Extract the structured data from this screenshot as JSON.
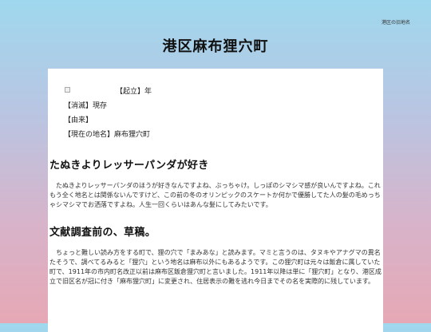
{
  "nav": {
    "old_names_link": "港区の旧地名"
  },
  "header": {
    "title": "港区麻布狸穴町"
  },
  "info": {
    "established": "【起立】年",
    "abolished": "【消滅】現存",
    "origin": "【由来】",
    "current_name": "【現在の地名】麻布狸穴町"
  },
  "sections": [
    {
      "heading": "たぬきよりレッサーパンダが好き",
      "body": "たぬきよりレッサーパンダのほうが好きなんですよね、ぶっちゃけ。しっぽのシマシマ感が良いんですよね。これもう全く地名とは関係ないんですけど、この前の冬のオリンピックのスケートか何かで優勝してた人の髪の毛めっちゃシマシマでお洒落ですよね。人生一回くらいはあんな髪にしてみたいです。"
    },
    {
      "heading": "文献調査前の、草稿。",
      "body": "ちょっと難しい読み方をする町で、狸の穴で「まみあな」と読みます。マミと言うのは、タヌキやアナグマの異名たそうで、調べてるみると「狸穴」という地名は麻布以外にもあるようです。この狸穴町は元々は飯倉に属していた町で、1911年の市内町名改正以前は麻布区飯倉狸穴町と言いました。1911年以降は単に「狸穴町」となり、港区成立で旧区名が冠に付き「麻布狸穴町」に変更され、住居表示の難を逃れ今日までその名を実際的に残しています。"
    }
  ]
}
